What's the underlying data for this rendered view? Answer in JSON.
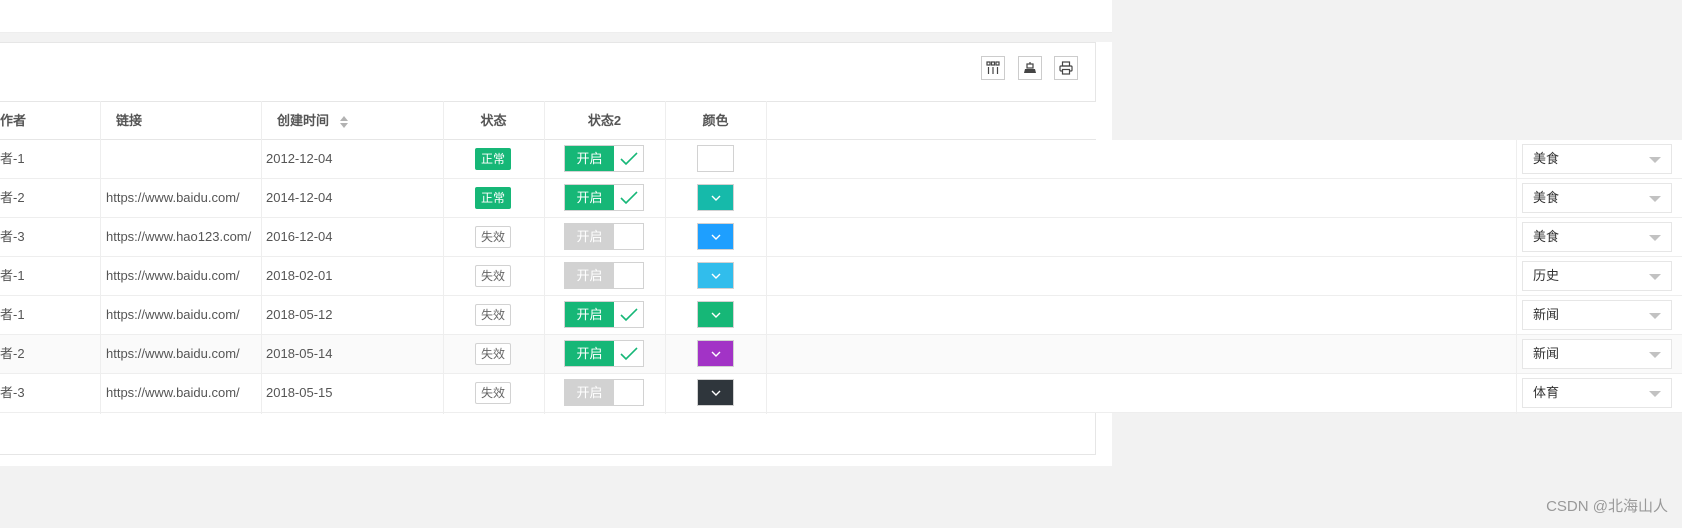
{
  "toolbar": {
    "icons": [
      "columns-icon",
      "export-icon",
      "print-icon"
    ]
  },
  "columns": {
    "author": "作者",
    "link": "链接",
    "created": "创建时间",
    "status": "状态",
    "status2": "状态2",
    "color": "颜色"
  },
  "rows": [
    {
      "author": "者-1",
      "link": "",
      "created": "2012-12-04",
      "status": "正常",
      "status_ok": true,
      "switch": "开启",
      "switch_on": true,
      "color": "#ffffff",
      "category": "美食"
    },
    {
      "author": "者-2",
      "link": "https://www.baidu.com/",
      "created": "2014-12-04",
      "status": "正常",
      "status_ok": true,
      "switch": "开启",
      "switch_on": true,
      "color": "#16baaa",
      "category": "美食"
    },
    {
      "author": "者-3",
      "link": "https://www.hao123.com/",
      "created": "2016-12-04",
      "status": "失效",
      "status_ok": false,
      "switch": "开启",
      "switch_on": false,
      "color": "#1e9fff",
      "category": "美食"
    },
    {
      "author": "者-1",
      "link": "https://www.baidu.com/",
      "created": "2018-02-01",
      "status": "失效",
      "status_ok": false,
      "switch": "开启",
      "switch_on": false,
      "color": "#31bdec",
      "category": "历史"
    },
    {
      "author": "者-1",
      "link": "https://www.baidu.com/",
      "created": "2018-05-12",
      "status": "失效",
      "status_ok": false,
      "switch": "开启",
      "switch_on": true,
      "color": "#16b777",
      "category": "新闻"
    },
    {
      "author": "者-2",
      "link": "https://www.baidu.com/",
      "created": "2018-05-14",
      "status": "失效",
      "status_ok": false,
      "switch": "开启",
      "switch_on": true,
      "color": "#a233c6",
      "category": "新闻"
    },
    {
      "author": "者-3",
      "link": "https://www.baidu.com/",
      "created": "2018-05-15",
      "status": "失效",
      "status_ok": false,
      "switch": "开启",
      "switch_on": false,
      "color": "#2f363c",
      "category": "体育"
    }
  ],
  "colors": {
    "accent": "#16b777",
    "border": "#e6e6e6"
  },
  "watermark": "CSDN @北海山人"
}
